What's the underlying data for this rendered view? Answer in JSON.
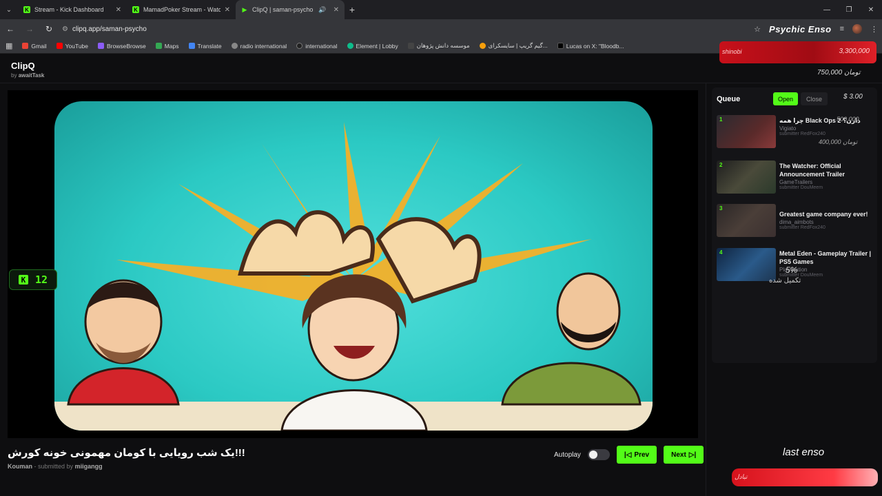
{
  "browser": {
    "tabs": [
      {
        "title": "Stream - Kick Dashboard",
        "icon": "kick-icon"
      },
      {
        "title": "MamadPoker Stream - Watch L",
        "icon": "kick-icon"
      },
      {
        "title": "ClipQ | saman-psycho",
        "icon": "play-icon"
      }
    ],
    "url": "clipq.app/saman-psycho",
    "bookmarks": [
      {
        "label": "Gmail",
        "color": "#ea4335"
      },
      {
        "label": "YouTube",
        "color": "#ff0000"
      },
      {
        "label": "BrowseBrowse",
        "color": "#8b5cf6"
      },
      {
        "label": "Maps",
        "color": "#34a853"
      },
      {
        "label": "Translate",
        "color": "#4285f4"
      },
      {
        "label": "radio international",
        "color": "#888888"
      },
      {
        "label": "international",
        "color": "#222222"
      },
      {
        "label": "Element | Lobby",
        "color": "#0dbd8b"
      },
      {
        "label": "موسسه دانش پژوهان",
        "color": "#444444"
      },
      {
        "label": "گیم گریپ | سایسکرای...",
        "color": "#f59e0b"
      },
      {
        "label": "Lucas on X: \"Bloodb...",
        "color": "#000000"
      }
    ],
    "overlay_name": "Psychic Enso"
  },
  "app": {
    "logo": "ClipQ",
    "by_prefix": "by",
    "by_author": "awaitTask"
  },
  "player": {
    "kick_count": "12",
    "video_title": "یک شب رویایی با کومان مهمونی خونه کورش!!!",
    "channel": "Kouman",
    "submitted_prefix": "- submitted by",
    "submitter": "miigangg"
  },
  "controls": {
    "autoplay_label": "Autoplay",
    "autoplay_on": false,
    "prev_label": "Prev",
    "next_label": "Next"
  },
  "queue": {
    "title": "Queue",
    "open_label": "Open",
    "close_label": "Close",
    "items": [
      {
        "num": "1",
        "title": "چرا همه Black Ops 2 دارن؟",
        "channel": "Vigiato",
        "submitter": "submitter RedFox240",
        "thumb_color": "#5a2a2a"
      },
      {
        "num": "2",
        "title": "The Watcher: Official Announcement Trailer",
        "channel": "GameTrailers",
        "submitter": "submitter DouMeem",
        "thumb_color": "#2b3a2b"
      },
      {
        "num": "3",
        "title": "Greatest game company ever!",
        "channel": "dima_aimbots",
        "submitter": "submitter RedFox240",
        "thumb_color": "#3b3030"
      },
      {
        "num": "4",
        "title": "Metal Eden - Gameplay Trailer | PS5 Games",
        "channel": "PlayStation",
        "submitter": "submitter DouMeem",
        "thumb_color": "#1d3550"
      }
    ]
  },
  "overlay": {
    "top_name": "shinobi",
    "top_amount": "3,300,000",
    "amount_2": "750,000 تومان",
    "amount_3": "$ 3.00",
    "amount_4": "500,000",
    "amount_5": "400,000 تومان",
    "percent": "5%",
    "percent_sub": "تکمیل شده",
    "last_label": "last enso",
    "bottom_text": "تبادل"
  }
}
